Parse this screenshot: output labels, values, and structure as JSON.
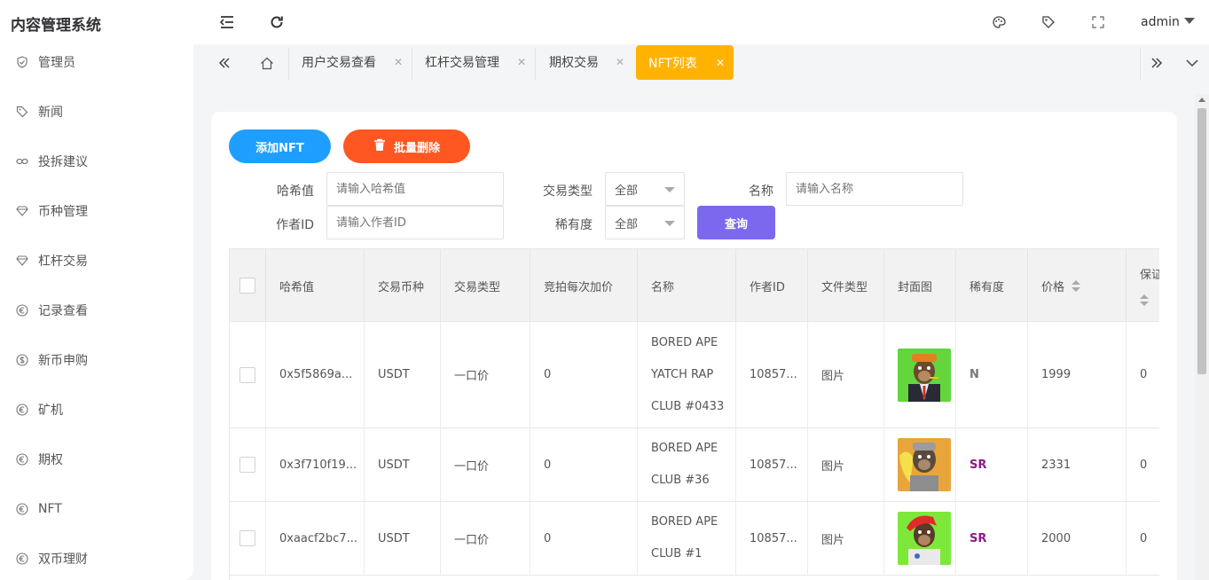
{
  "header": {
    "title": "内容管理系统",
    "user": "admin"
  },
  "sidebar": {
    "items": [
      {
        "label": "管理员",
        "icon": "shield-icon"
      },
      {
        "label": "新闻",
        "icon": "tag-icon"
      },
      {
        "label": "投拆建议",
        "icon": "link-icon"
      },
      {
        "label": "币种管理",
        "icon": "diamond-icon"
      },
      {
        "label": "杠杆交易",
        "icon": "diamond-icon"
      },
      {
        "label": "记录查看",
        "icon": "euro-circle-icon"
      },
      {
        "label": "新币申购",
        "icon": "dollar-circle-icon"
      },
      {
        "label": "矿机",
        "icon": "euro-circle-icon"
      },
      {
        "label": "期权",
        "icon": "euro-circle-icon"
      },
      {
        "label": "NFT",
        "icon": "euro-circle-icon"
      },
      {
        "label": "双币理财",
        "icon": "euro-circle-icon"
      }
    ]
  },
  "tabs": [
    {
      "label": "用户交易查看"
    },
    {
      "label": "杠杆交易管理"
    },
    {
      "label": "期权交易"
    },
    {
      "label": "NFT列表",
      "active": true
    }
  ],
  "toolbar": {
    "add_label": "添加NFT",
    "delete_label": "批量删除",
    "query_label": "查询"
  },
  "filters": {
    "hash_label": "哈希值",
    "hash_placeholder": "请输入哈希值",
    "trade_type_label": "交易类型",
    "trade_type_value": "全部",
    "name_label": "名称",
    "name_placeholder": "请输入名称",
    "author_label": "作者ID",
    "author_placeholder": "请输入作者ID",
    "rarity_label": "稀有度",
    "rarity_value": "全部"
  },
  "table": {
    "columns": [
      "哈希值",
      "交易币种",
      "交易类型",
      "竞拍每次加价",
      "名称",
      "作者ID",
      "文件类型",
      "封面图",
      "稀有度",
      "价格",
      "保证"
    ],
    "rows": [
      {
        "hash": "0x5f5869a...",
        "coin": "USDT",
        "type": "一口价",
        "increment": "0",
        "name": "BORED APE YATCH RAP CLUB #0433",
        "author": "10857...",
        "file_type": "图片",
        "rarity": "N",
        "rarity_color": "#777777",
        "price": "1999",
        "deposit": "0"
      },
      {
        "hash": "0x3f710f19...",
        "coin": "USDT",
        "type": "一口价",
        "increment": "0",
        "name": "BORED APE CLUB #36",
        "author": "10857...",
        "file_type": "图片",
        "rarity": "SR",
        "rarity_color": "#8b1a89",
        "price": "2331",
        "deposit": "0"
      },
      {
        "hash": "0xaacf2bc7...",
        "coin": "USDT",
        "type": "一口价",
        "increment": "0",
        "name": "BORED APE CLUB #1",
        "author": "10857...",
        "file_type": "图片",
        "rarity": "SR",
        "rarity_color": "#8b1a89",
        "price": "2000",
        "deposit": "0"
      }
    ]
  },
  "colors": {
    "accent_tab": "#ffb300",
    "add_button": "#1e9fff",
    "delete_button": "#ff5722",
    "query_button": "#7b68ee"
  }
}
